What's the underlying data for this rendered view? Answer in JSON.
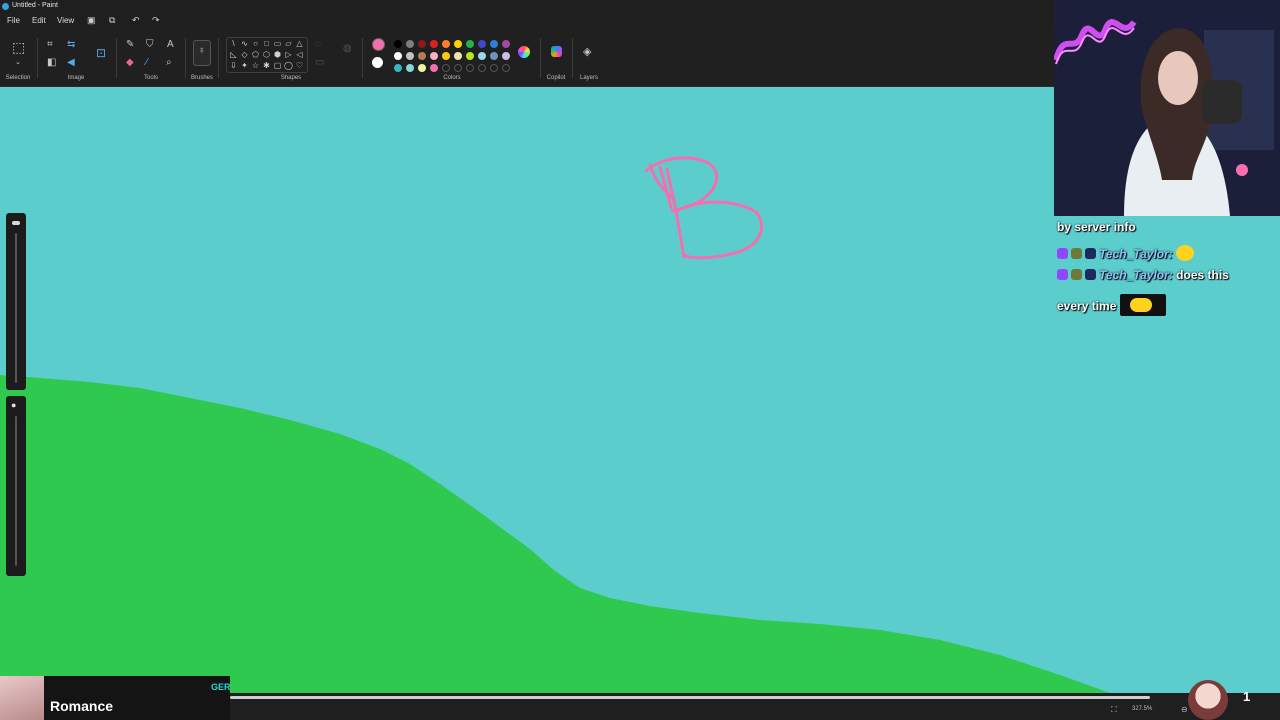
{
  "window": {
    "title": "Untitled - Paint"
  },
  "menu": {
    "items": [
      "File",
      "Edit",
      "View"
    ],
    "icons": [
      "save-icon",
      "share-icon",
      "undo-icon",
      "redo-icon"
    ]
  },
  "ribbon": {
    "groups": {
      "selection": "Selection",
      "image": "Image",
      "tools": "Tools",
      "brushes": "Brushes",
      "shapes": "Shapes",
      "colors": "Colors",
      "copilot": "Copilot",
      "layers": "Layers"
    },
    "shape_glyphs": [
      "\\",
      "∿",
      "○",
      "□",
      "▭",
      "▱",
      "△",
      "◺",
      "◇",
      "⬠",
      "⬡",
      "⬢",
      "▷",
      "◁",
      "⇩",
      "✦",
      "☆",
      "✱",
      "▢",
      "◯",
      "♡",
      "",
      "",
      "",
      "",
      "",
      "",
      ""
    ],
    "primary_color": "#f46fb0",
    "secondary_color": "#ffffff",
    "swatches": [
      "#000000",
      "#7f7f7f",
      "#8b1a1a",
      "#e02020",
      "#ff7f27",
      "#ffd400",
      "#22b14c",
      "#3f48cc",
      "#2f7fd8",
      "#a349a4",
      "#ffffff",
      "#c3c3c3",
      "#b97a57",
      "#ffaec9",
      "#ffc90e",
      "#efe4b0",
      "#b5e61d",
      "#99d9ea",
      "#7092be",
      "#c8bfe7",
      "#38b5c0",
      "#86d8d8",
      "#f5f5a0",
      "#f46fb0",
      "",
      "",
      "",
      "",
      "",
      ""
    ]
  },
  "canvas": {
    "sky_color": "#5ccdcd",
    "ground_color": "#2fc94f",
    "drawn_letter_color": "#f46fb0"
  },
  "chat": {
    "header": "by server info",
    "messages": [
      {
        "user": "Tech_Taylor:",
        "text": ""
      },
      {
        "user": "Tech_Taylor:",
        "text": "does this"
      }
    ],
    "continuation": "every time"
  },
  "now_playing": {
    "title": "Romance",
    "tag": "GER"
  },
  "status": {
    "zoom": "327.5%",
    "count": "1"
  }
}
